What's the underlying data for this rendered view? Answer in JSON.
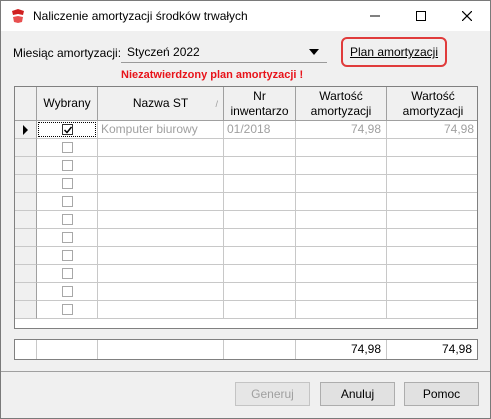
{
  "window": {
    "title": "Naliczenie amortyzacji środków trwałych",
    "controls": [
      "minimize-icon",
      "maximize-icon",
      "close-icon"
    ]
  },
  "month": {
    "label": "Miesiąc amortyzacji:",
    "value": "Styczeń 2022"
  },
  "plan_button": {
    "label": "Plan amortyzacji"
  },
  "warning": {
    "text": "Niezatwierdzony plan amortyzacji !",
    "color": "#e8131a"
  },
  "table": {
    "headers": {
      "selected": "Wybrany",
      "name": "Nazwa ST",
      "inv_line1": "Nr",
      "inv_line2": "inwentarzo",
      "val1_line1": "Wartość",
      "val1_line2": "amortyzacji",
      "val2_line1": "Wartość",
      "val2_line2": "amortyzacji"
    },
    "rows": [
      {
        "checked": true,
        "name": "Komputer biurowy",
        "inventory_no": "01/2018",
        "value1": "74,98",
        "value2": "74,98"
      },
      {
        "checked": false,
        "name": "",
        "inventory_no": "",
        "value1": "",
        "value2": ""
      },
      {
        "checked": false,
        "name": "",
        "inventory_no": "",
        "value1": "",
        "value2": ""
      },
      {
        "checked": false,
        "name": "",
        "inventory_no": "",
        "value1": "",
        "value2": ""
      },
      {
        "checked": false,
        "name": "",
        "inventory_no": "",
        "value1": "",
        "value2": ""
      },
      {
        "checked": false,
        "name": "",
        "inventory_no": "",
        "value1": "",
        "value2": ""
      },
      {
        "checked": false,
        "name": "",
        "inventory_no": "",
        "value1": "",
        "value2": ""
      },
      {
        "checked": false,
        "name": "",
        "inventory_no": "",
        "value1": "",
        "value2": ""
      },
      {
        "checked": false,
        "name": "",
        "inventory_no": "",
        "value1": "",
        "value2": ""
      },
      {
        "checked": false,
        "name": "",
        "inventory_no": "",
        "value1": "",
        "value2": ""
      },
      {
        "checked": false,
        "name": "",
        "inventory_no": "",
        "value1": "",
        "value2": ""
      }
    ],
    "totals": {
      "value1": "74,98",
      "value2": "74,98"
    }
  },
  "buttons": {
    "generate": "Generuj",
    "cancel": "Anuluj",
    "help": "Pomoc"
  }
}
